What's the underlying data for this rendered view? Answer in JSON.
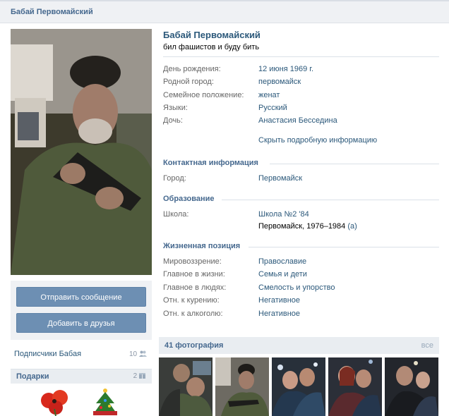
{
  "header": {
    "title": "Бабай Первомайский"
  },
  "profile": {
    "name": "Бабай Первомайский",
    "status": "бил фашистов и буду бить"
  },
  "info": [
    {
      "label": "День рождения:",
      "value": "12 июня 1969 г."
    },
    {
      "label": "Родной город:",
      "value": "первомайск"
    },
    {
      "label": "Семейное положение:",
      "value": "женат"
    },
    {
      "label": "Языки:",
      "value": "Русский"
    },
    {
      "label": "Дочь:",
      "value": "Анастасия Бесседина"
    }
  ],
  "hide_link": "Скрыть подробную информацию",
  "contacts": {
    "heading": "Контактная информация",
    "rows": [
      {
        "label": "Город:",
        "value": "Первомайск"
      }
    ]
  },
  "education": {
    "heading": "Образование",
    "label": "Школа:",
    "school": "Школа №2 '84",
    "details": "Первомайск, 1976–1984",
    "details_suffix": "(а)"
  },
  "position": {
    "heading": "Жизненная позиция",
    "rows": [
      {
        "label": "Мировоззрение:",
        "value": "Православие"
      },
      {
        "label": "Главное в жизни:",
        "value": "Семья и дети"
      },
      {
        "label": "Главное в людях:",
        "value": "Смелость и упорство"
      },
      {
        "label": "Отн. к курению:",
        "value": "Негативное"
      },
      {
        "label": "Отн. к алкоголю:",
        "value": "Негативное"
      }
    ]
  },
  "buttons": {
    "send_message": "Отправить сообщение",
    "add_friend": "Добавить в друзья"
  },
  "followers": {
    "label": "Подписчики Бабая",
    "count": "10"
  },
  "gifts": {
    "heading": "Подарки",
    "count": "2"
  },
  "photos": {
    "heading": "41 фотография",
    "all_link": "все"
  },
  "colors": {
    "link": "#2b587a",
    "heading": "#45688e",
    "button": "#6d8fb3",
    "panel": "#eff1f4"
  }
}
